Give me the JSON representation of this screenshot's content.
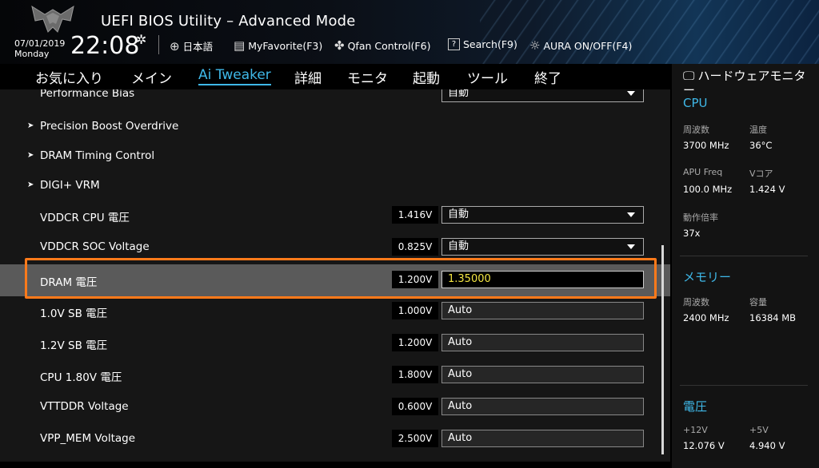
{
  "header": {
    "title": "UEFI BIOS Utility – Advanced Mode",
    "date": "07/01/2019",
    "weekday": "Monday",
    "time": "22:08",
    "language": "日本語",
    "myfavorite": "MyFavorite(F3)",
    "qfan": "Qfan Control(F6)",
    "search": "Search(F9)",
    "aura": "AURA ON/OFF(F4)"
  },
  "tabs": [
    "お気に入り",
    "メイン",
    "Ai Tweaker",
    "詳細",
    "モニタ",
    "起動",
    "ツール",
    "終了"
  ],
  "active_tab": "Ai Tweaker",
  "rows": {
    "perf_bias": {
      "label": "Performance Bias",
      "value": "自動"
    },
    "pbo": {
      "label": "Precision Boost Overdrive"
    },
    "dram_timing": {
      "label": "DRAM Timing Control"
    },
    "digi_vrm": {
      "label": "DIGI+ VRM"
    },
    "vddcr_cpu": {
      "label": "VDDCR CPU 電圧",
      "voltage": "1.416V",
      "value": "自動"
    },
    "vddcr_soc": {
      "label": "VDDCR SOC Voltage",
      "voltage": "0.825V",
      "value": "自動"
    },
    "dram_v": {
      "label": "DRAM 電圧",
      "voltage": "1.200V",
      "value": "1.35000"
    },
    "sb_10": {
      "label": "1.0V SB 電圧",
      "voltage": "1.000V",
      "value": "Auto"
    },
    "sb_12": {
      "label": "1.2V SB 電圧",
      "voltage": "1.200V",
      "value": "Auto"
    },
    "cpu_18": {
      "label": "CPU 1.80V 電圧",
      "voltage": "1.800V",
      "value": "Auto"
    },
    "vttddr": {
      "label": "VTTDDR Voltage",
      "voltage": "0.600V",
      "value": "Auto"
    },
    "vpp_mem": {
      "label": "VPP_MEM Voltage",
      "voltage": "2.500V",
      "value": "Auto"
    }
  },
  "monitor": {
    "title": "ハードウェアモニター",
    "cpu": {
      "heading": "CPU",
      "freq_label": "周波数",
      "freq": "3700 MHz",
      "temp_label": "温度",
      "temp": "36°C",
      "apu_label": "APU Freq",
      "apu": "100.0 MHz",
      "vcore_label": "Vコア",
      "vcore": "1.424 V",
      "ratio_label": "動作倍率",
      "ratio": "37x"
    },
    "memory": {
      "heading": "メモリー",
      "freq_label": "周波数",
      "freq": "2400 MHz",
      "cap_label": "容量",
      "cap": "16384 MB"
    },
    "voltage": {
      "heading": "電圧",
      "v12_label": "+12V",
      "v12": "12.076 V",
      "v5_label": "+5V",
      "v5": "4.940 V"
    }
  },
  "colors": {
    "accent": "#3fb8e8",
    "highlight_box": "#ff7a1a",
    "edit_value": "#f4e642"
  }
}
